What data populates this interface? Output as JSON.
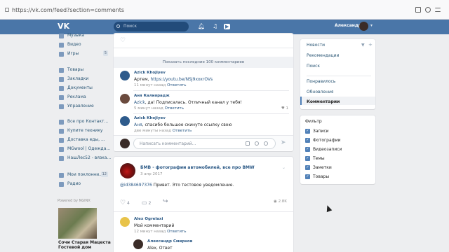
{
  "browser": {
    "url": "https://vk.com/feed?section=comments"
  },
  "header": {
    "logo": "VK",
    "search_placeholder": "Поиск",
    "user_name": "Александр"
  },
  "sidebar": {
    "items": [
      {
        "label": "Музыка",
        "count": ""
      },
      {
        "label": "Видео",
        "count": ""
      },
      {
        "label": "Игры",
        "count": "5"
      },
      {
        "label": "Товары",
        "count": ""
      },
      {
        "label": "Закладки",
        "count": ""
      },
      {
        "label": "Документы",
        "count": ""
      },
      {
        "label": "Реклама",
        "count": ""
      },
      {
        "label": "Управление",
        "count": ""
      },
      {
        "label": "Все про Контакт...",
        "count": ""
      },
      {
        "label": "Купите технику",
        "count": ""
      },
      {
        "label": "Доставка еды, ...",
        "count": ""
      },
      {
        "label": "MGwool | Одежда...",
        "count": ""
      },
      {
        "label": "НашЛес52 - вязка...",
        "count": ""
      },
      {
        "label": "Мои поклонни...",
        "count": "12"
      },
      {
        "label": "Радио",
        "count": ""
      }
    ],
    "ad_caption": "Powered by NGINX",
    "ad_text": "Сочи Старая Мацеста Гостевой дом"
  },
  "feed": {
    "show_more": "Показать последние 100 комментариев",
    "comments": [
      {
        "name": "Azick Khojiyev",
        "text_prefix": "Артем, ",
        "text_link": "https://youtu.be/NSJ9xoxrOVs",
        "text_rest": "",
        "time": "11 минут назад",
        "reply": "Ответить",
        "likes": ""
      },
      {
        "name": "Аня Калиярадж",
        "text_prefix": "",
        "text_link": "Azick",
        "text_rest": ", да! Подписалась. Отличный канал у тебя!",
        "time": "5 минут назад",
        "reply": "Ответить",
        "likes": "1"
      },
      {
        "name": "Azick Khojiyev",
        "text_prefix": "",
        "text_link": "Аня",
        "text_rest": ", спасибо большое скинуте ссылку свою",
        "time": "две минуты назад",
        "reply": "Ответить",
        "likes": ""
      }
    ],
    "reply_placeholder": "Написать комментарий...",
    "post": {
      "author": "БМВ - фотографии автомобилей, все про BMW",
      "date": "3 апр 2017",
      "text_link": "@id384697376",
      "text_rest": " Привет. Это тестовое уведомление.",
      "likes": "4",
      "comments": "2",
      "views": "2.8K"
    },
    "sub_comments": [
      {
        "name": "Alex Ogrelaxi",
        "text": "Мой комментарий",
        "time": "12 минут назад",
        "reply": "Ответить"
      },
      {
        "name": "Александр Смирнов",
        "text": "Alex, Ответ",
        "time": "",
        "reply": ""
      }
    ]
  },
  "right_nav": {
    "items": [
      "Новости",
      "Рекомендации",
      "Поиск",
      "Понравилось",
      "Обновления",
      "Комментарии"
    ],
    "filter_title": "Фильтр",
    "filters": [
      "Записи",
      "Фотографии",
      "Видеозаписи",
      "Темы",
      "Заметки",
      "Товары"
    ]
  },
  "colors": {
    "header": "#4a76a8",
    "link": "#2a5885",
    "accent": "#5181b8"
  }
}
